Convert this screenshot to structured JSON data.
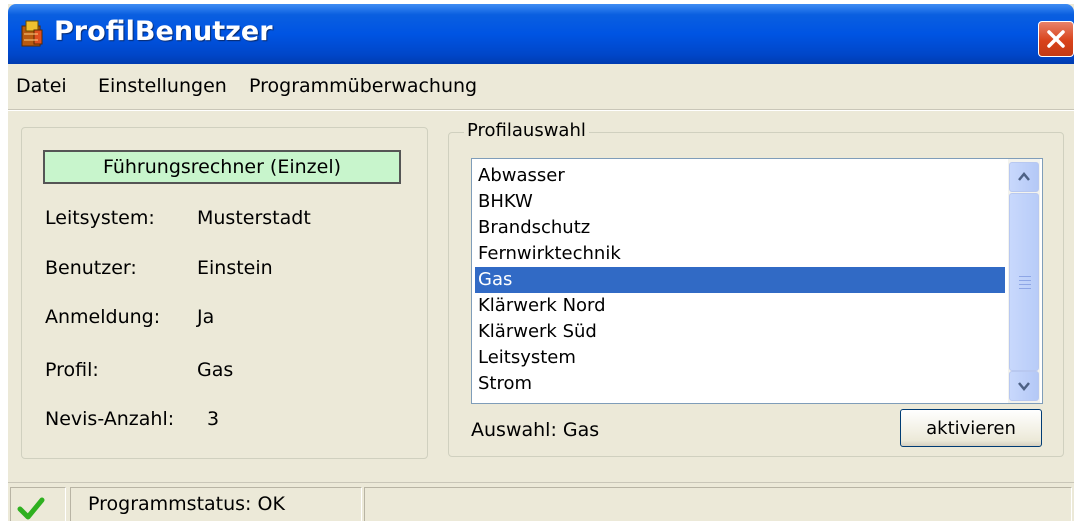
{
  "window": {
    "title": "ProfilBenutzer"
  },
  "menu": {
    "items": [
      "Datei",
      "Einstellungen",
      "Programmüberwachung"
    ]
  },
  "info": {
    "role": "Führungsrechner (Einzel)",
    "fields": [
      {
        "label": "Leitsystem:",
        "value": "Musterstadt"
      },
      {
        "label": "Benutzer:",
        "value": "Einstein"
      },
      {
        "label": "Anmeldung:",
        "value": "Ja"
      },
      {
        "label": "Profil:",
        "value": "Gas"
      },
      {
        "label": "Nevis-Anzahl:",
        "value": "3"
      }
    ]
  },
  "profile": {
    "legend": "Profilauswahl",
    "items": [
      "Abwasser",
      "BHKW",
      "Brandschutz",
      "Fernwirktechnik",
      "Gas",
      "Klärwerk Nord",
      "Klärwerk Süd",
      "Leitsystem",
      "Strom"
    ],
    "selected_index": 4,
    "selection_text": "Auswahl: Gas",
    "activate_label": "aktivieren"
  },
  "status": {
    "text": "Programmstatus: OK"
  },
  "colors": {
    "titlebar": "#0054e3",
    "selection": "#316ac5",
    "role_bg": "#c8f5cc",
    "ok_check": "#2fb020"
  },
  "icons": {
    "app": "app-icon",
    "close": "close-icon",
    "status": "check-icon"
  }
}
